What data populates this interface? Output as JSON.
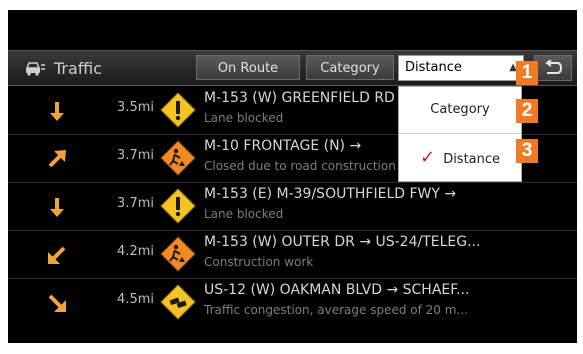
{
  "header": {
    "title": "Traffic",
    "tabs": [
      {
        "label": "On Route"
      },
      {
        "label": "Category"
      }
    ],
    "sort_selected": "Distance",
    "back_icon": "back-arrow-icon"
  },
  "sort_menu": {
    "items": [
      {
        "label": "Category",
        "checked": false
      },
      {
        "label": "Distance",
        "checked": true
      }
    ]
  },
  "callouts": [
    "1",
    "2",
    "3"
  ],
  "incidents": [
    {
      "direction": "down",
      "distance": "3.5mi",
      "icon": "alert-icon",
      "road": "M-153 (W) GREENFIELD RD",
      "desc": "Lane blocked"
    },
    {
      "direction": "up-right",
      "distance": "3.7mi",
      "icon": "construction-icon",
      "road": "M-10 FRONTAGE (N) → ",
      "desc": "Closed due to road construction"
    },
    {
      "direction": "down",
      "distance": "3.7mi",
      "icon": "alert-icon",
      "road": "M-153 (E) M-39/SOUTHFIELD FWY →",
      "desc": "Lane blocked"
    },
    {
      "direction": "down-left",
      "distance": "4.2mi",
      "icon": "construction-icon",
      "road": "M-153 (W) OUTER DR → US-24/TELEG...",
      "desc": "Construction work"
    },
    {
      "direction": "down-right",
      "distance": "4.5mi",
      "icon": "congestion-icon",
      "road": "US-12 (W) OAKMAN BLVD → SCHAEF...",
      "desc": "Traffic congestion, average speed of 20 m..."
    }
  ],
  "colors": {
    "accent": "#f07b22",
    "check": "#c8202a",
    "background": "#000000"
  }
}
